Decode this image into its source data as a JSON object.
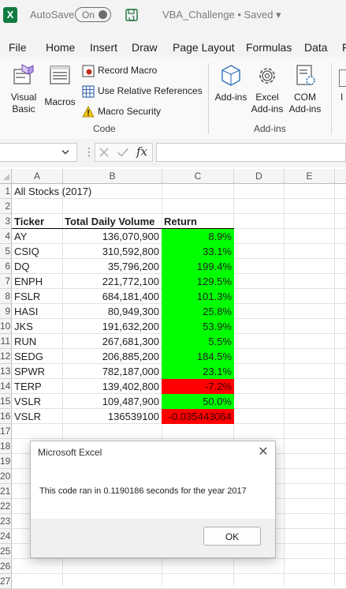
{
  "titlebar": {
    "autosave_label": "AutoSave",
    "autosave_state": "On",
    "doc_title": "VBA_Challenge • Saved ▾"
  },
  "tabs": [
    "File",
    "Home",
    "Insert",
    "Draw",
    "Page Layout",
    "Formulas",
    "Data",
    "F"
  ],
  "ribbon": {
    "visual_basic": "Visual Basic",
    "macros": "Macros",
    "record_macro": "Record Macro",
    "use_relative": "Use Relative References",
    "macro_security": "Macro Security",
    "code_group": "Code",
    "addins": "Add-ins",
    "excel_addins": "Excel Add-ins",
    "com_addins": "COM Add-ins",
    "addins_group": "Add-ins",
    "cut_off": "I"
  },
  "formula_bar": {
    "fx": "fx"
  },
  "sheet": {
    "columns": [
      "A",
      "B",
      "C",
      "D",
      "E"
    ],
    "rows": [
      "1",
      "2",
      "3",
      "4",
      "5",
      "6",
      "7",
      "8",
      "9",
      "10",
      "11",
      "12",
      "13",
      "14",
      "15",
      "16",
      "17",
      "18",
      "19",
      "20",
      "21",
      "22",
      "23",
      "24",
      "25",
      "26",
      "27"
    ],
    "title": "All Stocks (2017)",
    "headers": [
      "Ticker",
      "Total Daily Volume",
      "Return"
    ],
    "data": [
      {
        "ticker": "AY",
        "volume": "136,070,900",
        "ret": "8.9%",
        "status": "positive"
      },
      {
        "ticker": "CSIQ",
        "volume": "310,592,800",
        "ret": "33.1%",
        "status": "positive"
      },
      {
        "ticker": "DQ",
        "volume": "35,796,200",
        "ret": "199.4%",
        "status": "positive"
      },
      {
        "ticker": "ENPH",
        "volume": "221,772,100",
        "ret": "129.5%",
        "status": "positive"
      },
      {
        "ticker": "FSLR",
        "volume": "684,181,400",
        "ret": "101.3%",
        "status": "positive"
      },
      {
        "ticker": "HASI",
        "volume": "80,949,300",
        "ret": "25.8%",
        "status": "positive"
      },
      {
        "ticker": "JKS",
        "volume": "191,632,200",
        "ret": "53.9%",
        "status": "positive"
      },
      {
        "ticker": "RUN",
        "volume": "267,681,300",
        "ret": "5.5%",
        "status": "positive"
      },
      {
        "ticker": "SEDG",
        "volume": "206,885,200",
        "ret": "184.5%",
        "status": "positive"
      },
      {
        "ticker": "SPWR",
        "volume": "782,187,000",
        "ret": "23.1%",
        "status": "positive"
      },
      {
        "ticker": "TERP",
        "volume": "139,402,800",
        "ret": "-7.2%",
        "status": "negative"
      },
      {
        "ticker": "VSLR",
        "volume": "109,487,900",
        "ret": "50.0%",
        "status": "positive"
      },
      {
        "ticker": "VSLR",
        "volume": "136539100",
        "ret": "-0.035443064",
        "status": "negative"
      }
    ],
    "colors": {
      "positive": "#00ff00",
      "negative": "#ff0000"
    }
  },
  "dialog": {
    "title": "Microsoft Excel",
    "message": "This code ran in 0.1190186 seconds for the year 2017",
    "ok": "OK",
    "close": "✕"
  }
}
